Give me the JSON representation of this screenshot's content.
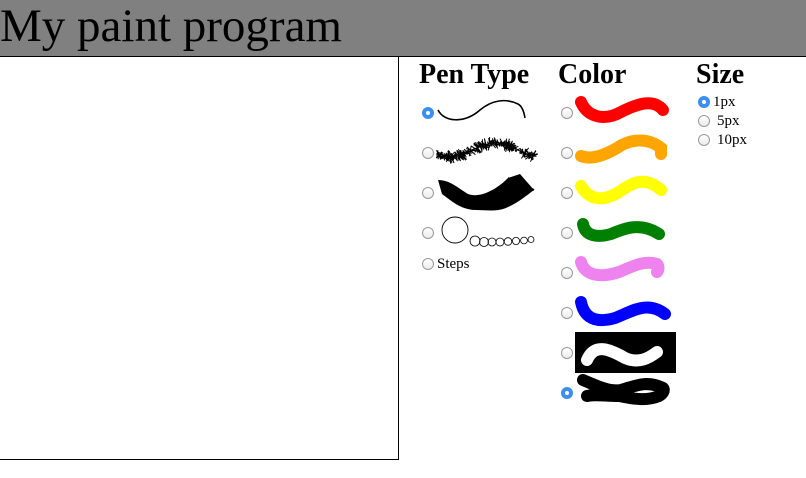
{
  "header": {
    "title": "My paint program",
    "background_color": "#808080"
  },
  "pen_type": {
    "heading": "Pen Type",
    "options": [
      {
        "name": "thin-line",
        "selected": true
      },
      {
        "name": "spray",
        "selected": false
      },
      {
        "name": "ribbon",
        "selected": false
      },
      {
        "name": "circles",
        "selected": false
      },
      {
        "name": "steps",
        "label": "Steps",
        "selected": false
      }
    ]
  },
  "color": {
    "heading": "Color",
    "options": [
      {
        "name": "red",
        "hex": "#ff0000",
        "selected": false
      },
      {
        "name": "orange",
        "hex": "#ffa500",
        "selected": false
      },
      {
        "name": "yellow",
        "hex": "#ffff00",
        "selected": false
      },
      {
        "name": "green",
        "hex": "#008000",
        "selected": false
      },
      {
        "name": "violet",
        "hex": "#ee82ee",
        "selected": false
      },
      {
        "name": "blue",
        "hex": "#0000ff",
        "selected": false
      },
      {
        "name": "white",
        "hex": "#ffffff",
        "selected": false
      },
      {
        "name": "black",
        "hex": "#000000",
        "selected": true
      }
    ]
  },
  "size": {
    "heading": "Size",
    "options": [
      {
        "label": "1px",
        "selected": true
      },
      {
        "label": "5px",
        "selected": false
      },
      {
        "label": "10px",
        "selected": false
      }
    ]
  }
}
